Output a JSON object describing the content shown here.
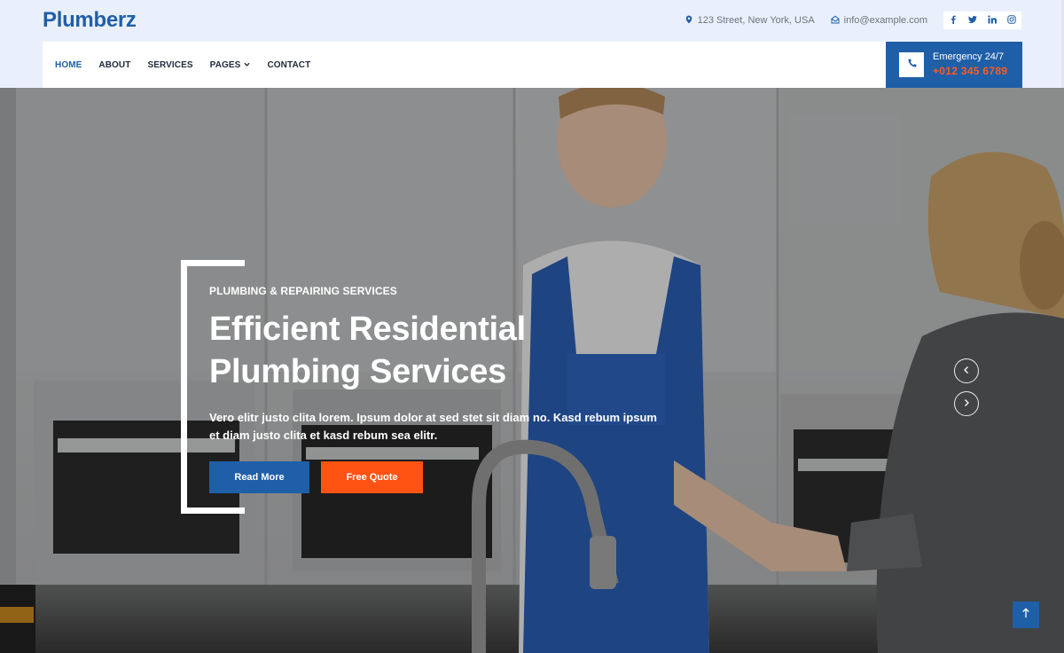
{
  "brand": {
    "name": "Plumberz",
    "color": "#1f5fa8"
  },
  "topbar": {
    "address": "123 Street, New York, USA",
    "email": "info@example.com",
    "address_icon": "map-marker-icon",
    "email_icon": "envelope-open-icon",
    "socials": [
      {
        "name": "facebook",
        "glyph": "f"
      },
      {
        "name": "twitter",
        "glyph": "t"
      },
      {
        "name": "linkedin",
        "glyph": "in"
      },
      {
        "name": "instagram",
        "glyph": "ig"
      }
    ]
  },
  "nav": {
    "items": [
      {
        "label": "HOME",
        "active": true
      },
      {
        "label": "ABOUT",
        "active": false
      },
      {
        "label": "SERVICES",
        "active": false
      },
      {
        "label": "PAGES",
        "active": false,
        "dropdown": true
      },
      {
        "label": "CONTACT",
        "active": false
      }
    ]
  },
  "emergency": {
    "label": "Emergency 24/7",
    "phone": "+012 345 6789",
    "icon": "phone-icon"
  },
  "hero": {
    "subtitle": "PLUMBING & REPAIRING SERVICES",
    "title_line1": "Efficient Residential",
    "title_line2": "Plumbing Services",
    "description": "Vero elitr justo clita lorem. Ipsum dolor at sed stet sit diam no. Kasd rebum ipsum et diam justo clita et kasd rebum sea elitr.",
    "primary_button": "Read More",
    "secondary_button": "Free Quote",
    "image_description": "Smiling plumber in blue overalls shaking hands with a blonde woman in a modern kitchen"
  },
  "carousel": {
    "prev_icon": "chevron-left-icon",
    "next_icon": "chevron-right-icon"
  },
  "back_to_top": {
    "icon": "arrow-up-icon"
  },
  "colors": {
    "primary": "#1f5fa8",
    "accent": "#ff5314",
    "topbar_bg": "#eaf0fb"
  }
}
